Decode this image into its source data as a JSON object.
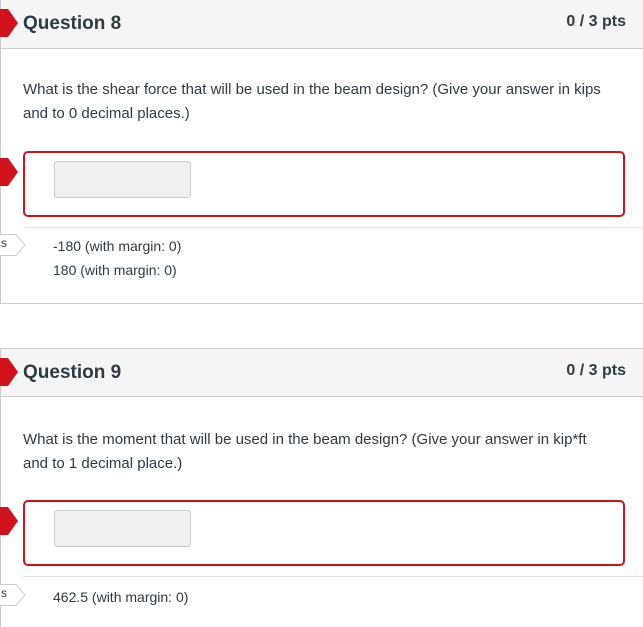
{
  "questions": [
    {
      "title": "Question 8",
      "points": "0 / 3 pts",
      "text": "What is the shear force that will be used in the beam design? (Give your answer in kips and to 0 decimal places.)",
      "input_value": "",
      "tab_label": "s",
      "correct_answers": [
        "-180 (with margin: 0)",
        "180 (with margin: 0)"
      ]
    },
    {
      "title": "Question 9",
      "points": "0 / 3 pts",
      "text": "What is the moment that will be used in the beam design? (Give your answer in kip*ft and to 1 decimal place.)",
      "input_value": "",
      "tab_label": "s",
      "correct_answers": [
        "462.5 (with margin: 0)"
      ]
    }
  ],
  "colors": {
    "incorrect": "#d0121b",
    "header_bg": "#f5f5f5",
    "text": "#2d3b45",
    "border": "#c7cdd1"
  }
}
